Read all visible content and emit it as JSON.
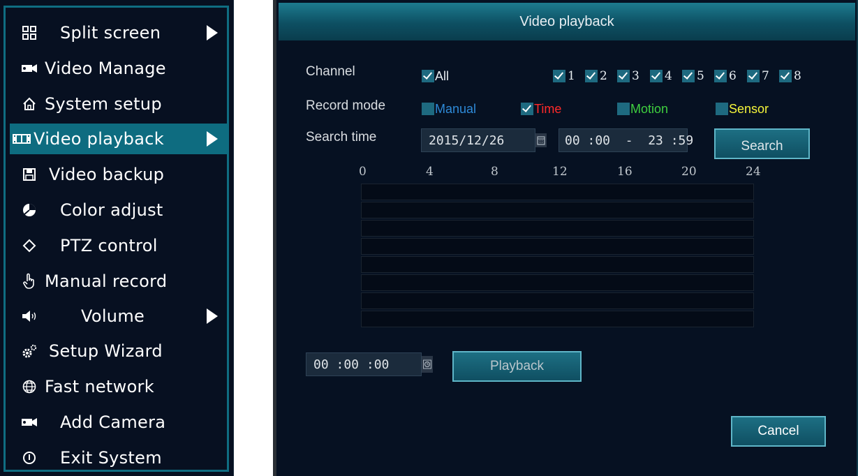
{
  "menu": {
    "items": [
      {
        "label": "Split screen",
        "icon": "split-screen-icon",
        "has_submenu": true,
        "active": false
      },
      {
        "label": "Video Manage",
        "icon": "camera-icon",
        "has_submenu": false,
        "active": false
      },
      {
        "label": "System setup",
        "icon": "home-icon",
        "has_submenu": false,
        "active": false
      },
      {
        "label": "Video playback",
        "icon": "film-icon",
        "has_submenu": true,
        "active": true
      },
      {
        "label": "Video backup",
        "icon": "floppy-disk-icon",
        "has_submenu": false,
        "active": false
      },
      {
        "label": "Color adjust",
        "icon": "color-palette-icon",
        "has_submenu": false,
        "active": false
      },
      {
        "label": "PTZ control",
        "icon": "ptz-control-icon",
        "has_submenu": false,
        "active": false
      },
      {
        "label": "Manual record",
        "icon": "hand-pointer-icon",
        "has_submenu": false,
        "active": false
      },
      {
        "label": "Volume",
        "icon": "speaker-icon",
        "has_submenu": true,
        "active": false
      },
      {
        "label": "Setup Wizard",
        "icon": "gears-icon",
        "has_submenu": false,
        "active": false
      },
      {
        "label": "Fast network",
        "icon": "globe-icon",
        "has_submenu": false,
        "active": false
      },
      {
        "label": "Add Camera",
        "icon": "camera-icon",
        "has_submenu": false,
        "active": false
      },
      {
        "label": "Exit System",
        "icon": "power-icon",
        "has_submenu": false,
        "active": false
      }
    ]
  },
  "dialog": {
    "title": "Video playback",
    "channel_label": "Channel",
    "all_label": "All",
    "all_checked": true,
    "channels": [
      {
        "label": "1",
        "checked": true
      },
      {
        "label": "2",
        "checked": true
      },
      {
        "label": "3",
        "checked": true
      },
      {
        "label": "4",
        "checked": true
      },
      {
        "label": "5",
        "checked": true
      },
      {
        "label": "6",
        "checked": true
      },
      {
        "label": "7",
        "checked": true
      },
      {
        "label": "8",
        "checked": true
      }
    ],
    "record_mode_label": "Record mode",
    "modes": [
      {
        "label": "Manual",
        "checked": false,
        "color": "#2e8ad8"
      },
      {
        "label": "Time",
        "checked": true,
        "color": "#ff2a2a"
      },
      {
        "label": "Motion",
        "checked": false,
        "color": "#3fcf3f"
      },
      {
        "label": "Sensor",
        "checked": false,
        "color": "#f5f53a"
      }
    ],
    "search_time_label": "Search time",
    "date_value": "2015/12/26",
    "time_range_value": "00 :00  -  23 :59",
    "search_button": "Search",
    "timeline_ticks": [
      "0",
      "4",
      "8",
      "12",
      "16",
      "20",
      "24"
    ],
    "playback_time_value": "00 :00 :00",
    "playback_button": "Playback",
    "cancel_button": "Cancel"
  },
  "colors": {
    "menu_bg": "#071021",
    "menu_border": "#0f6d82",
    "active_item": "#0e6c80",
    "panel_bg": "#061122",
    "title_bar": "#1d7b8f"
  }
}
